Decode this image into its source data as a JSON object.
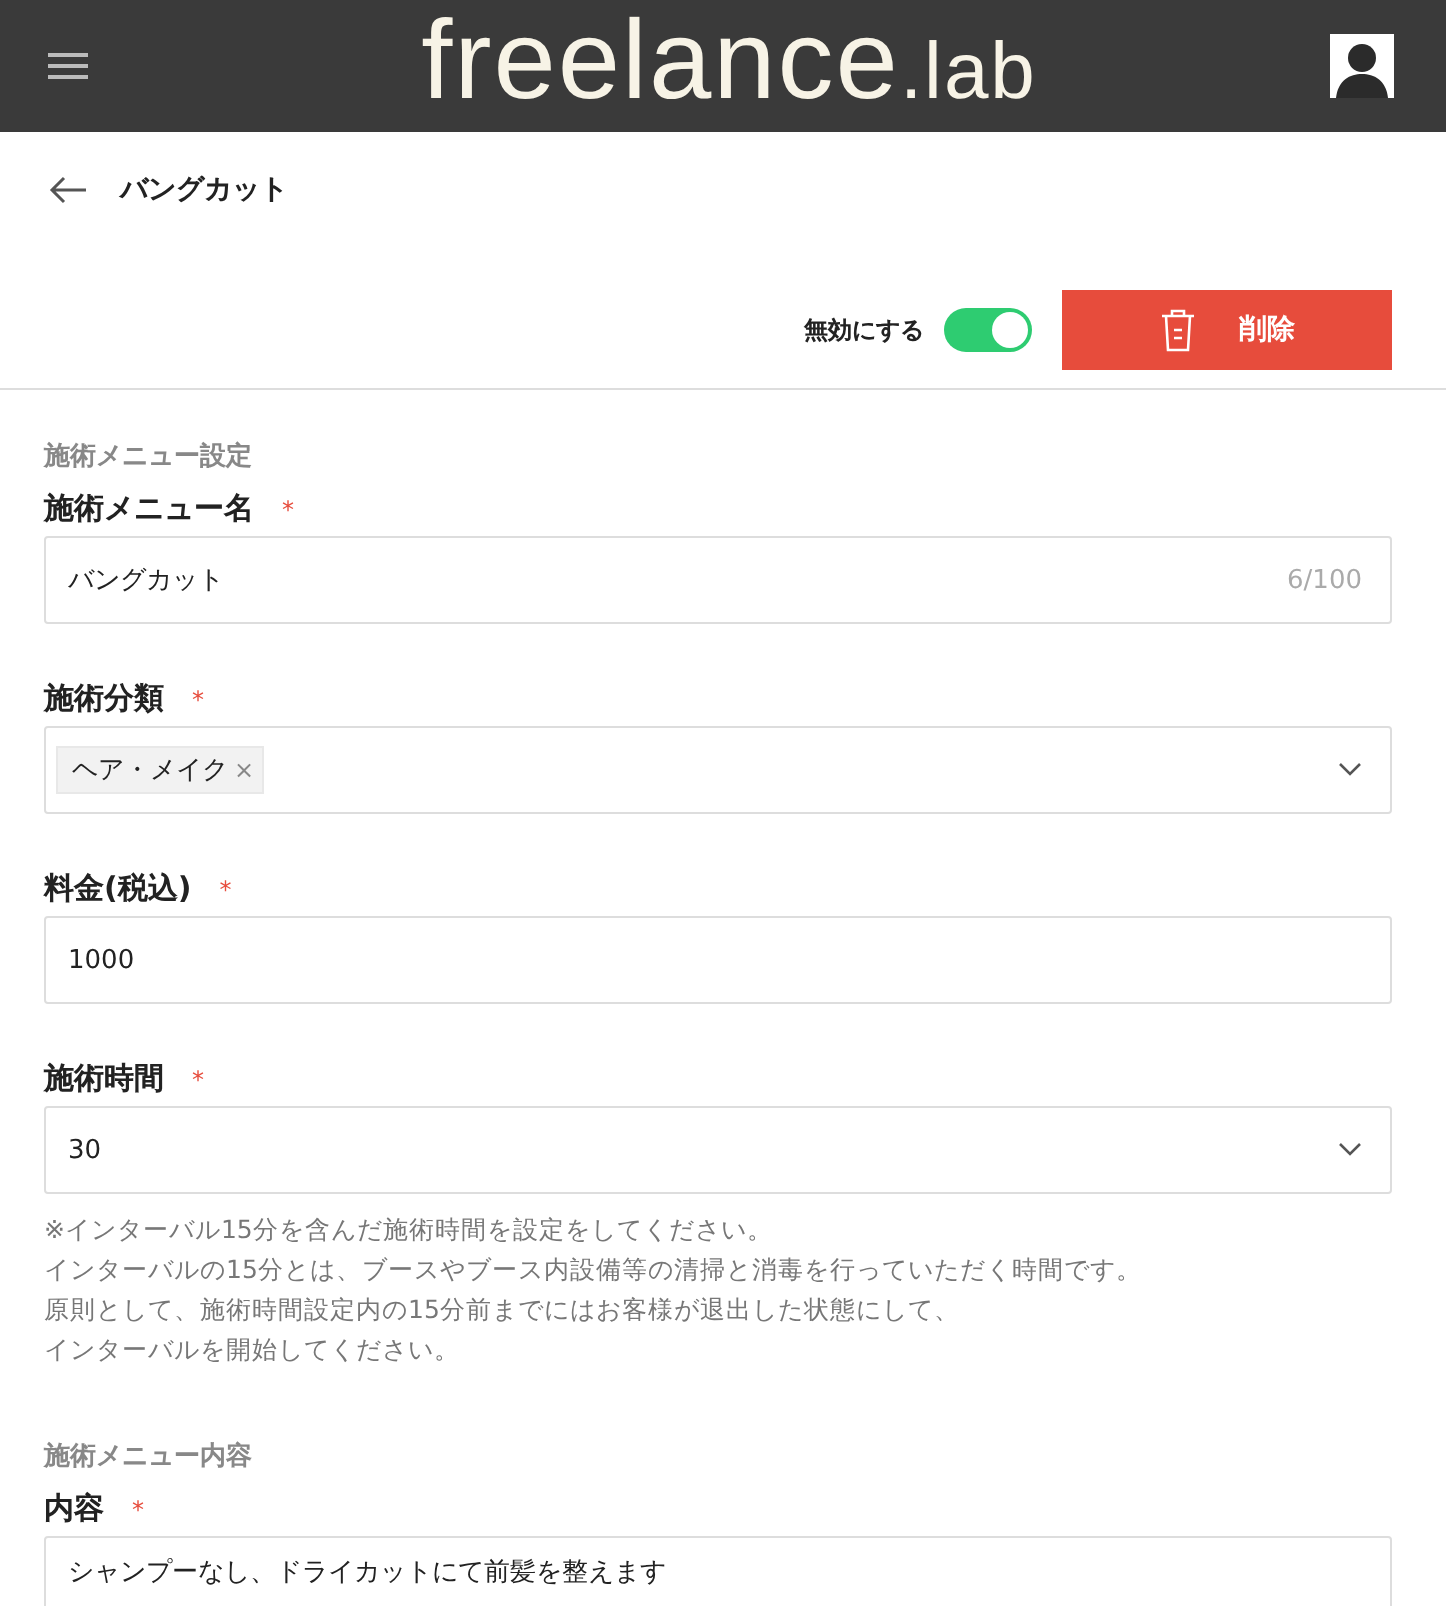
{
  "header": {
    "logo_main": "freelance",
    "logo_sub": ".lab"
  },
  "page": {
    "title": "バングカット"
  },
  "toolbar": {
    "toggle_label": "無効にする",
    "toggle_on": true,
    "delete_label": "削除"
  },
  "sections": [
    {
      "title": "施術メニュー設定",
      "fields": [
        {
          "kind": "text",
          "label": "施術メニュー名",
          "required_mark": "*",
          "value": "バングカット",
          "counter": "6/100"
        },
        {
          "kind": "tags",
          "label": "施術分類",
          "required_mark": "*",
          "tags": [
            {
              "label": "ヘア・メイク",
              "remove": "×"
            }
          ]
        },
        {
          "kind": "text",
          "label": "料金(税込)",
          "required_mark": "*",
          "value": "1000"
        },
        {
          "kind": "select",
          "label": "施術時間",
          "required_mark": "*",
          "value": "30",
          "note": [
            "※インターバル15分を含んだ施術時間を設定をしてください。",
            "インターバルの15分とは、ブースやブース内設備等の清掃と消毒を行っていただく時間です。",
            "原則として、施術時間設定内の15分前までにはお客様が退出した状態にして、",
            "インターバルを開始してください。"
          ]
        }
      ]
    },
    {
      "title": "施術メニュー内容",
      "fields": [
        {
          "kind": "textarea",
          "label": "内容",
          "required_mark": "*",
          "value": "シャンプーなし、ドライカットにて前髪を整えます"
        }
      ]
    }
  ]
}
